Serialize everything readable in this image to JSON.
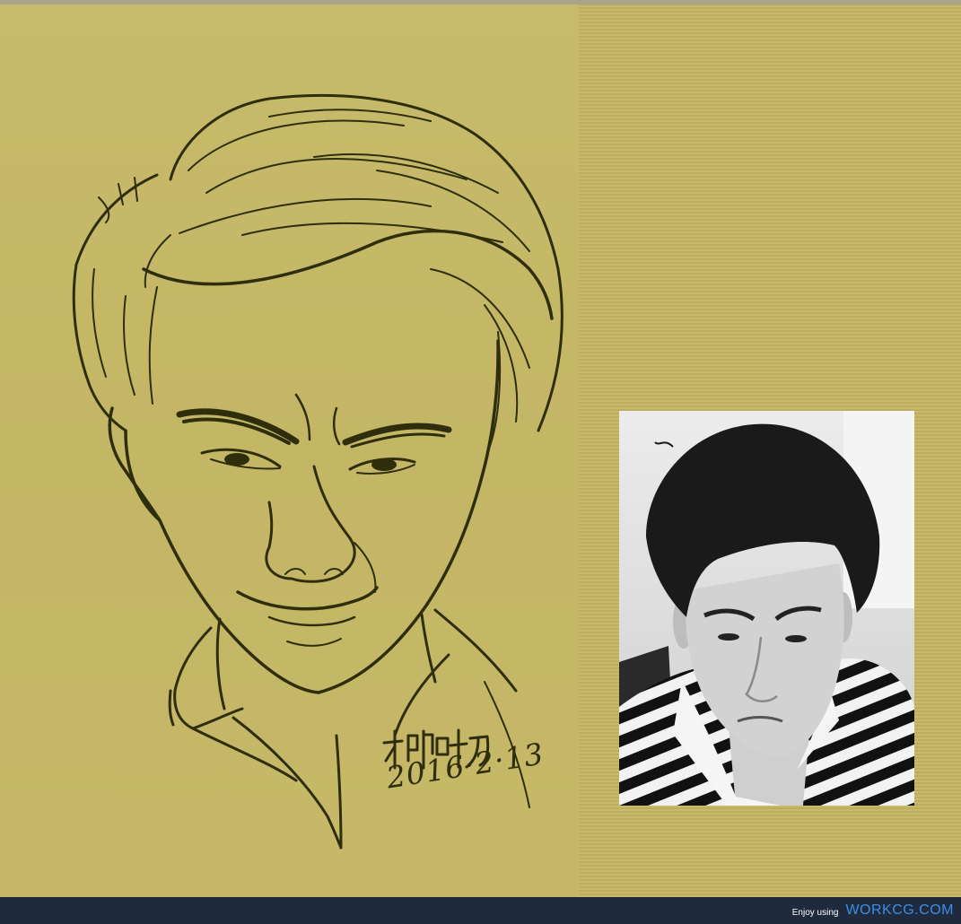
{
  "artwork": {
    "signature_name": "柳叶刀",
    "signature_date": "2016·2·13"
  },
  "footer": {
    "enjoy_text": "Enjoy using",
    "brand": "WORKCG.COM"
  },
  "colors": {
    "background": "#c4b766",
    "ink": "#2e2e0c",
    "footer_bg": "#1f2a3c",
    "brand": "#3c8ee6"
  }
}
